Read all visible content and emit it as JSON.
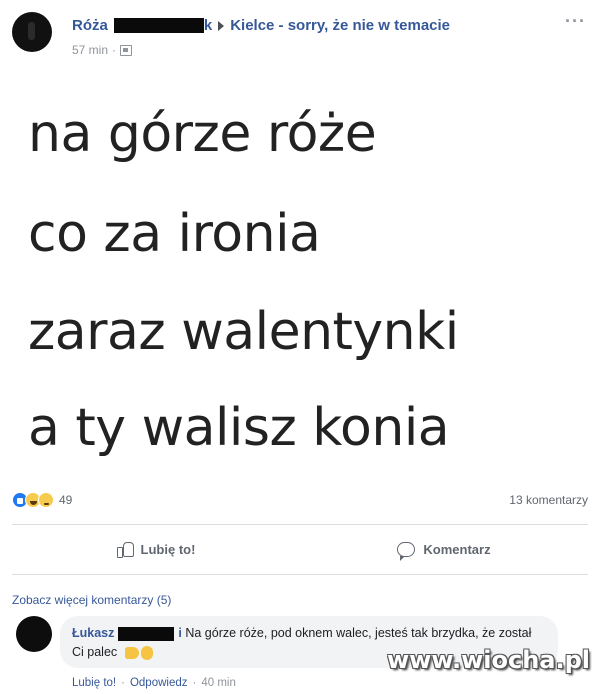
{
  "post": {
    "author_first": "Róża",
    "author_tail": "k",
    "group_name": "Kielce - sorry, że nie w temacie",
    "time": "57 min",
    "dot": "·",
    "more": "···"
  },
  "image_text": {
    "line1": "na górze róże",
    "line2": "co za ironia",
    "line3": "zaraz walentynki",
    "line4": "a ty walisz konia"
  },
  "reactions": {
    "count": "49",
    "comments_count": "13 komentarzy"
  },
  "actions": {
    "like_label": "Lubię to!",
    "comment_label": "Komentarz"
  },
  "comments": {
    "more_label": "Zobacz więcej komentarzy (5)",
    "first": {
      "author_first": "Łukasz",
      "author_tail": "i",
      "text": "Na górze róże, pod oknem walec, jesteś tak brzydka, że został Ci palec",
      "like_label": "Lubię to!",
      "reply_label": "Odpowiedz",
      "time": "40 min",
      "dot": "·"
    }
  },
  "watermark": "www.wiocha.pl",
  "colors": {
    "link": "#365899",
    "muted": "#90949c",
    "like_blue": "#2078f4",
    "emoji_yellow": "#f7cb4d",
    "bubble": "#f2f3f5"
  }
}
